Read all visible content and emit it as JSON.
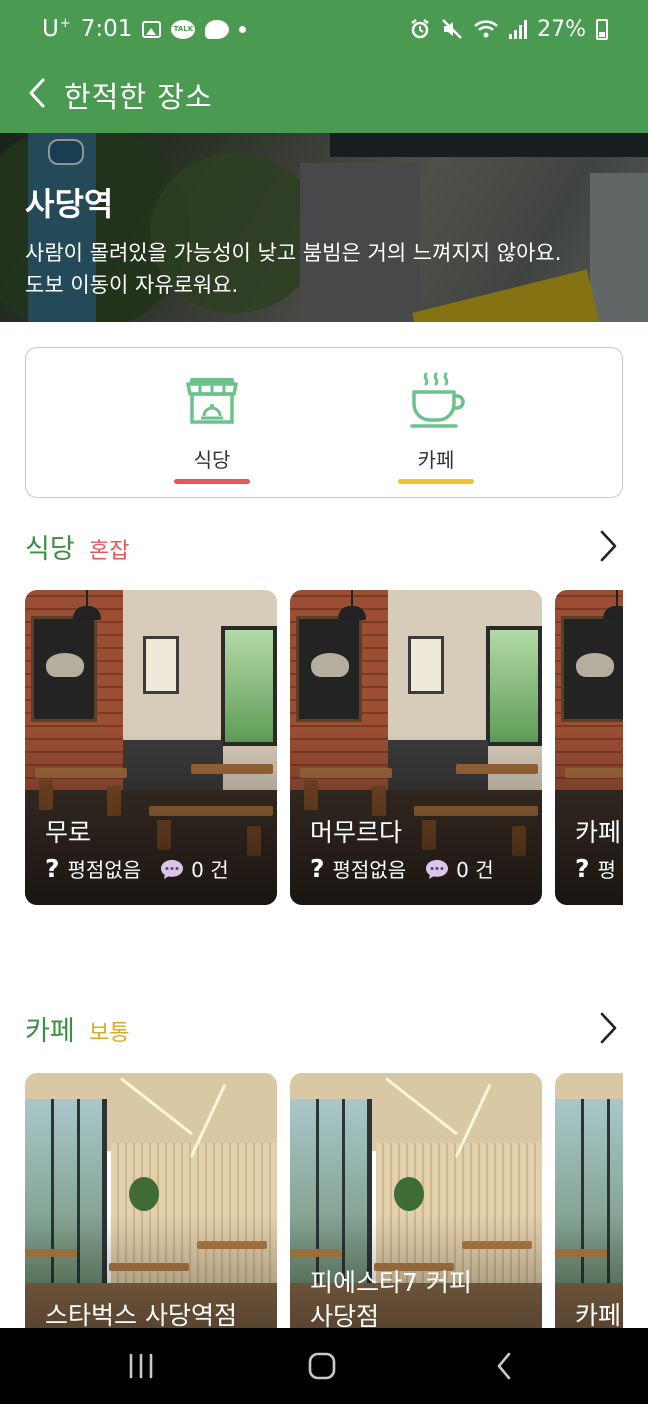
{
  "status_bar": {
    "carrier": "U",
    "carrier_sup": "+",
    "time": "7:01",
    "talk_icon_text": "TALK",
    "battery": "27%",
    "icons_left": [
      "photo-icon",
      "kakaotalk-icon",
      "bubble-icon",
      "dot-icon"
    ],
    "icons_right": [
      "alarm-icon",
      "mute-icon",
      "wifi-icon",
      "signal-icon",
      "battery-icon"
    ]
  },
  "app_bar": {
    "back_icon": "chevron-left-icon",
    "title": "한적한 장소"
  },
  "hero": {
    "title": "사당역",
    "description": "사람이 몰려있을 가능성이 낮고 붐빔은 거의 느껴지지 않아요.\n도보 이동이 자유로워요."
  },
  "categories": [
    {
      "label": "식당",
      "icon": "restaurant-store-icon",
      "underline_color": "#e4585a"
    },
    {
      "label": "카페",
      "icon": "coffee-cup-icon",
      "underline_color": "#f1c232"
    }
  ],
  "sections": [
    {
      "title": "식당",
      "badge": "혼잡",
      "badge_color": "#e4585a",
      "more_icon": "chevron-right-icon",
      "cards": [
        {
          "name": "무로",
          "rating_text": "평점없음",
          "review_count": "0 건"
        },
        {
          "name": "머무르다",
          "rating_text": "평점없음",
          "review_count": "0 건"
        },
        {
          "name": "카페",
          "rating_text": "평",
          "review_count": ""
        }
      ]
    },
    {
      "title": "카페",
      "badge": "보통",
      "badge_color": "#e0a81e",
      "more_icon": "chevron-right-icon",
      "cards": [
        {
          "name": "스타벅스 사당역점"
        },
        {
          "name": "피에스타7 커피\n사당점"
        },
        {
          "name": "카페"
        }
      ]
    }
  ],
  "colors": {
    "brand_green": "#4b9a52",
    "section_title_green": "#3f8c47",
    "category_icon_green": "#6cc28d"
  },
  "nav_bar": {
    "buttons": [
      "recent-apps-icon",
      "home-icon",
      "back-icon"
    ]
  }
}
